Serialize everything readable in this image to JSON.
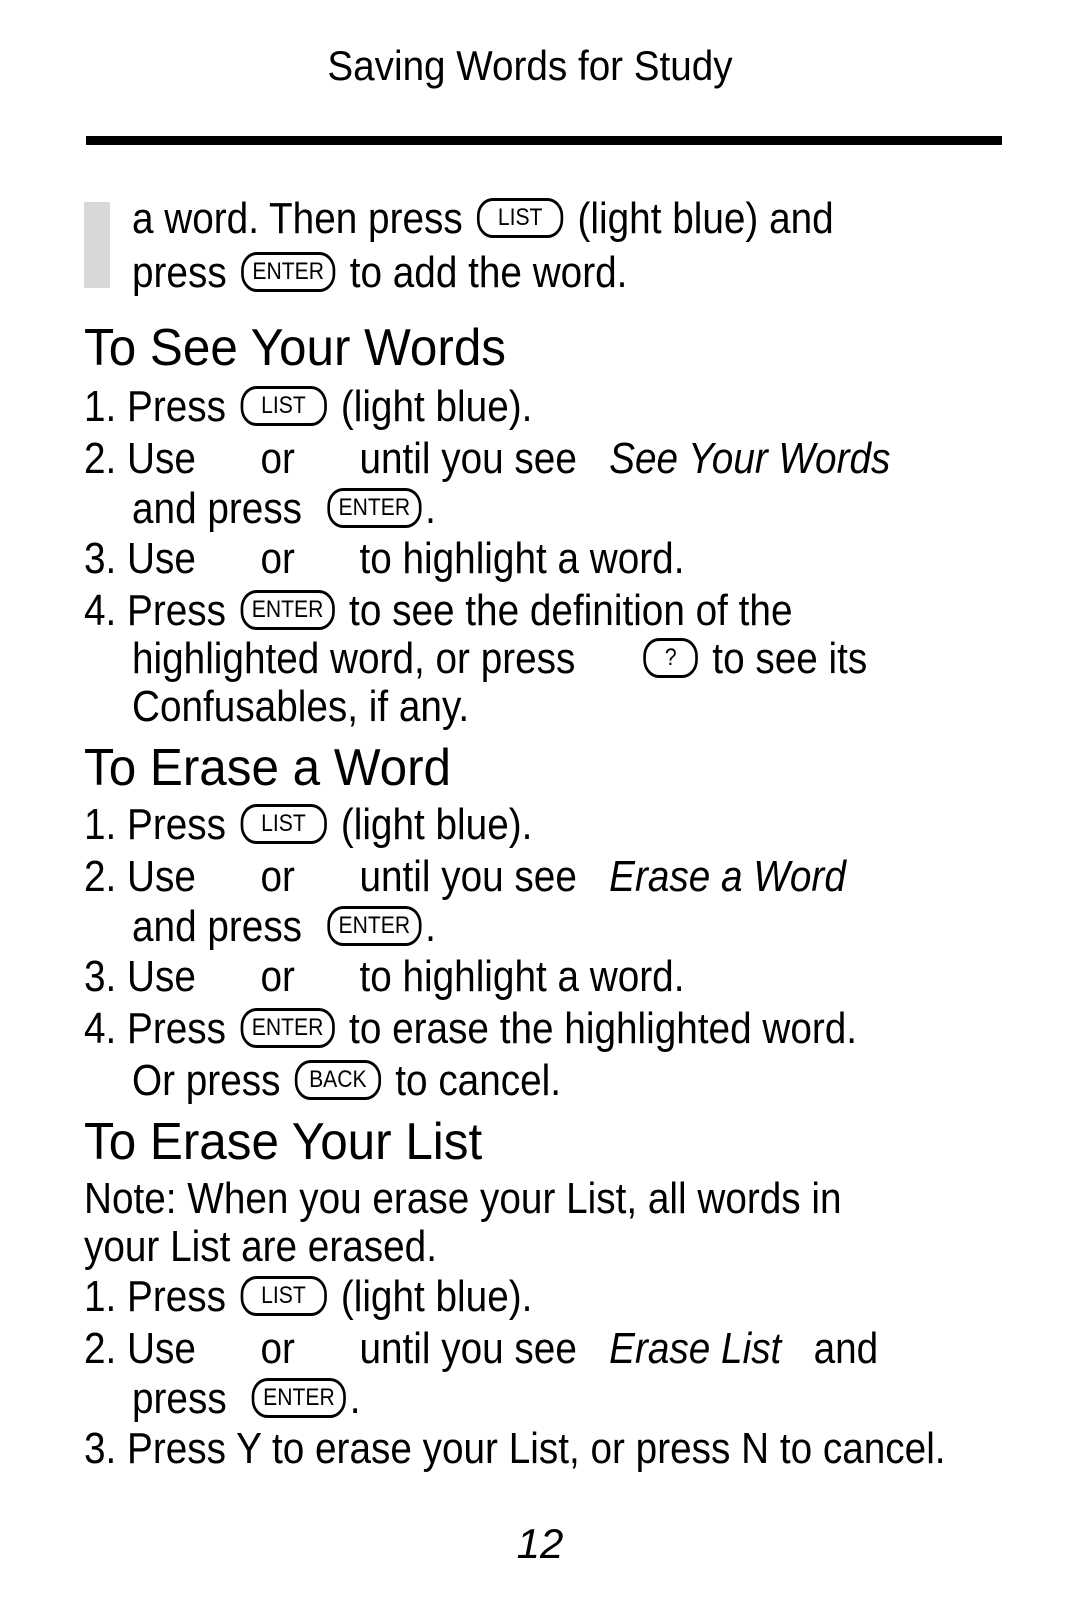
{
  "header": {
    "title": "Saving Words for Study"
  },
  "intro": {
    "line1_a": "a word. Then press",
    "line1_key": "LIST",
    "line1_b": "(light blue) and",
    "line2_a": "press",
    "line2_key": "ENTER",
    "line2_b": "to add the word."
  },
  "see": {
    "heading": "To See Your Words",
    "s1_a": "1. Press",
    "s1_key": "LIST",
    "s1_b": "(light blue).",
    "s2_a": "2. Use",
    "s2_or": "or",
    "s2_b": "until you see",
    "s2_em": "See Your Words",
    "s2c_a": "and press",
    "s2c_key": "ENTER",
    "s2c_b": ".",
    "s3_a": "3. Use",
    "s3_or": "or",
    "s3_b": "to highlight a word.",
    "s4_a": "4. Press",
    "s4_key": "ENTER",
    "s4_b": "to see the definition of the",
    "s4c_a": "highlighted word, or press",
    "s4c_key": "?",
    "s4c_b": "to see its",
    "s4d": "Confusables, if any."
  },
  "erase": {
    "heading": "To Erase a Word",
    "s1_a": "1. Press",
    "s1_key": "LIST",
    "s1_b": "(light blue).",
    "s2_a": "2. Use",
    "s2_or": "or",
    "s2_b": "until you see",
    "s2_em": "Erase a Word",
    "s2c_a": "and press",
    "s2c_key": "ENTER",
    "s2c_b": ".",
    "s3_a": "3. Use",
    "s3_or": "or",
    "s3_b": "to highlight a word.",
    "s4_a": "4. Press",
    "s4_key": "ENTER",
    "s4_b": "to erase the highlighted word.",
    "s4c_a": "Or press",
    "s4c_key": "BACK",
    "s4c_b": "to cancel."
  },
  "eraselist": {
    "heading": "To Erase Your List",
    "note1": "Note: When you erase your List, all words in",
    "note2": "your List are erased.",
    "s1_a": "1. Press",
    "s1_key": "LIST",
    "s1_b": "(light blue).",
    "s2_a": "2. Use",
    "s2_or": "or",
    "s2_b": "until you see",
    "s2_em": "Erase List",
    "s2_c": "and",
    "s2c_a": "press",
    "s2c_key": "ENTER",
    "s2c_b": ".",
    "s3": "3. Press Y to erase your List, or press N to cancel."
  },
  "page_number": "12"
}
